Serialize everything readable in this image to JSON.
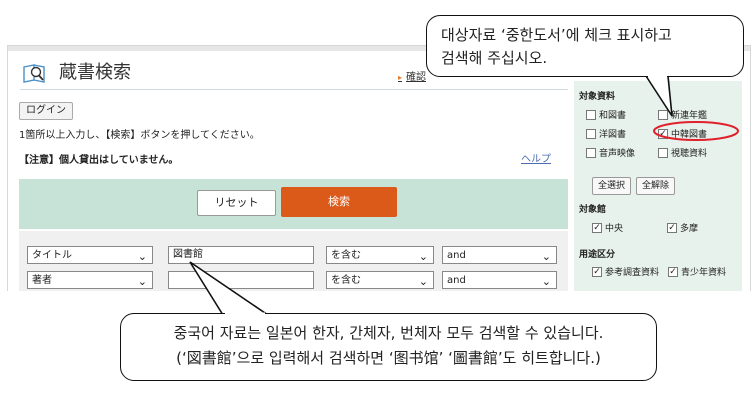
{
  "page": {
    "title": "蔵書検索",
    "top_link": "確認",
    "login_label": "ログイン",
    "instruction": "1箇所以上入力し、【検索】ボタンを押してください。",
    "notice": "【注意】個人貸出はしていません。",
    "help_label": "ヘルプ",
    "reset_label": "リセット",
    "search_label": "検索"
  },
  "search_rows": [
    {
      "field": "タイトル",
      "value": "図書館",
      "match": "を含む",
      "op": "and"
    },
    {
      "field": "著者",
      "value": "",
      "match": "を含む",
      "op": "and"
    }
  ],
  "sidebar": {
    "target_heading": "対象資料",
    "materials": [
      {
        "label": "和図書",
        "checked": false
      },
      {
        "label": "新連年鑑",
        "checked": false
      },
      {
        "label": "洋図書",
        "checked": false
      },
      {
        "label": "中韓図書",
        "checked": true
      },
      {
        "label": "音声映像",
        "checked": false
      },
      {
        "label": "視聴資料",
        "checked": false
      }
    ],
    "select_all": "全選択",
    "clear_all": "全解除",
    "library_heading": "対象館",
    "libraries": [
      {
        "label": "中央",
        "checked": true
      },
      {
        "label": "多摩",
        "checked": true
      }
    ],
    "use_heading": "用途区分",
    "uses": [
      {
        "label": "参考調査資料",
        "checked": true
      },
      {
        "label": "青少年資料",
        "checked": true
      }
    ]
  },
  "annotations": {
    "top_line1": "대상자료 ‘중한도서’에 체크 표시하고",
    "top_line2": "검색해 주십시오.",
    "bottom_line1": "중국어 자료는 일본어 한자, 간체자, 번체자 모두 검색할 수 있습니다.",
    "bottom_line2": "(‘図書館’으로 입력해서 검색하면 ‘图书馆’ ‘圖書館’도 히트합니다.)"
  },
  "colors": {
    "accent": "#dc5a19",
    "band": "#c7e3d7",
    "sidebar": "#e8f2ec",
    "highlight_ring": "#e0202a"
  }
}
